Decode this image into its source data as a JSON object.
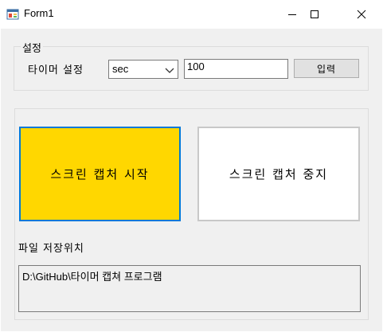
{
  "window": {
    "title": "Form1",
    "minimize_icon": "minimize-icon",
    "maximize_icon": "maximize-icon",
    "close_icon": "close-icon"
  },
  "settings_group": {
    "label": "설정",
    "timer_label": "타이머 설정",
    "unit_select": {
      "value": "sec",
      "icon": "chevron-down-icon"
    },
    "interval_input": {
      "value": "100"
    },
    "apply_button": "입력"
  },
  "capture_group": {
    "start_button": "스크린 캡처 시작",
    "stop_button": "스크린 캡처 중지",
    "save_path_label": "파일 저장위치",
    "save_path_value": "D:\\GitHub\\타이머 캡쳐 프로그램"
  },
  "colors": {
    "start_button_bg": "#ffd700",
    "start_button_border": "#0078d7",
    "client_bg": "#f0f0f0"
  }
}
